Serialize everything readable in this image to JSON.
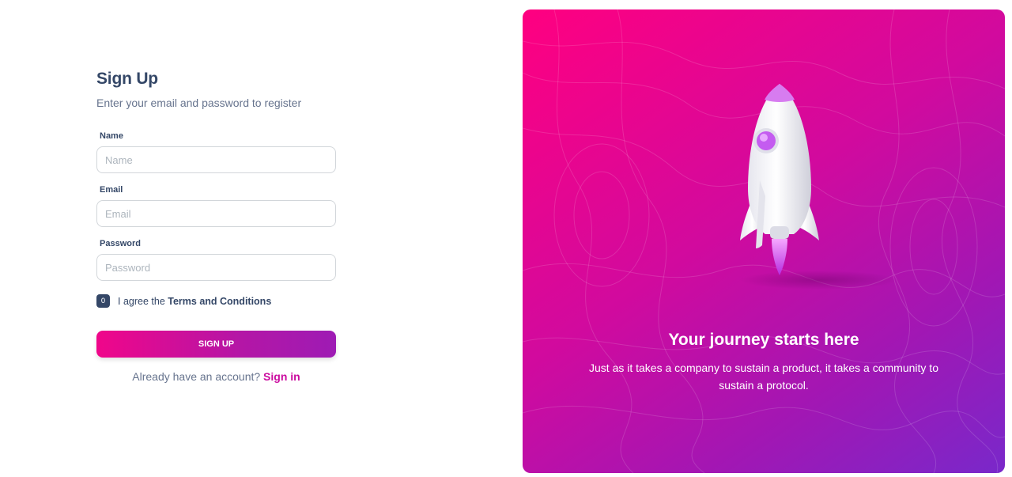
{
  "form": {
    "title": "Sign Up",
    "subtitle": "Enter your email and password to register",
    "name_label": "Name",
    "name_placeholder": "Name",
    "email_label": "Email",
    "email_placeholder": "Email",
    "password_label": "Password",
    "password_placeholder": "Password",
    "checkbox_glyph": "0",
    "agree_prefix": "I agree the ",
    "terms_link": "Terms and Conditions",
    "submit_label": "SIGN UP",
    "signin_prompt": "Already have an account? ",
    "signin_link": "Sign in"
  },
  "hero": {
    "title": "Your journey starts here",
    "text": "Just as it takes a company to sustain a product, it takes a community to sustain a protocol.",
    "gradient_start": "#ff0080",
    "gradient_end": "#7928ca"
  },
  "colors": {
    "heading": "#344767",
    "muted": "#67748e",
    "accent": "#cb0c9f"
  }
}
